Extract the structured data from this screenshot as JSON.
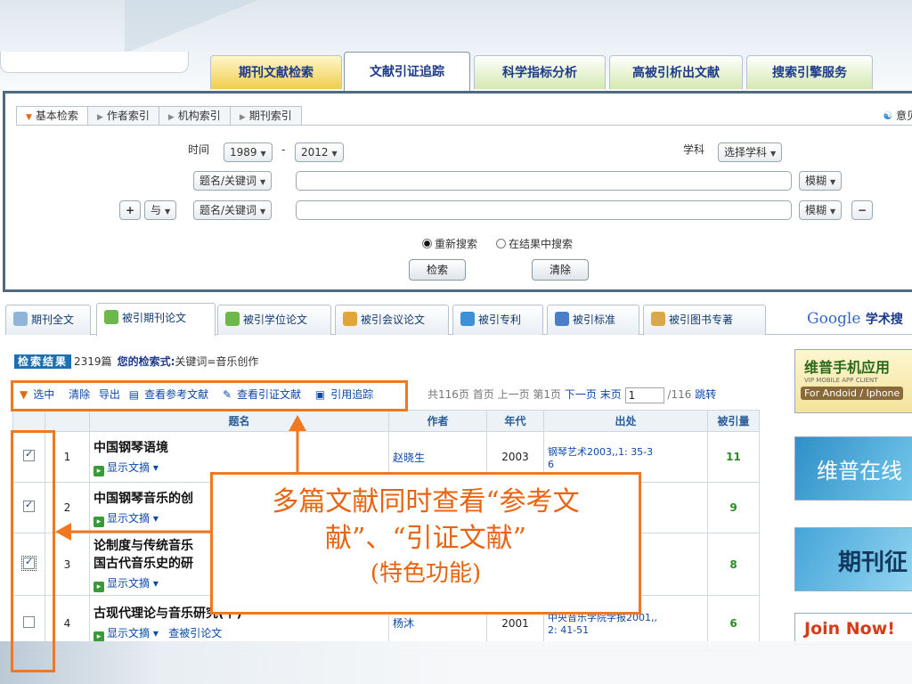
{
  "main_tabs": [
    "期刊文献检索",
    "文献引证追踪",
    "科学指标分析",
    "高被引析出文献",
    "搜索引擎服务"
  ],
  "sub_tabs": [
    "基本检索",
    "作者索引",
    "机构索引",
    "期刊索引"
  ],
  "feedback": "意见",
  "search": {
    "time_label": "时间",
    "year_from": "1989",
    "year_to": "2012",
    "dash": "-",
    "subject_label": "学科",
    "subject_value": "选择学科",
    "field1": "题名/关键词",
    "field2": "题名/关键词",
    "logic": "与",
    "plus": "+",
    "minus": "−",
    "match1": "模糊",
    "match2": "模糊",
    "radio_new": "重新搜索",
    "radio_within": "在结果中搜索",
    "search_btn": "检索",
    "clear_btn": "清除"
  },
  "result_tabs": [
    "期刊全文",
    "被引期刊论文",
    "被引学位论文",
    "被引会议论文",
    "被引专利",
    "被引标准",
    "被引图书专著"
  ],
  "google": {
    "logo": "Google",
    "suffix": "学术搜"
  },
  "result": {
    "header": "检索结果",
    "count": "2319篇",
    "query_label": "您的检索式:",
    "query_value": "关键词=音乐创作"
  },
  "tools": [
    "选中",
    "清除",
    "导出",
    "查看参考文献",
    "查看引证文献",
    "引用追踪"
  ],
  "pager": {
    "total": "共116页",
    "first": "首页",
    "prev": "上一页",
    "current": "第1页",
    "next": "下一页",
    "last": "末页",
    "page_value": "1",
    "of_total": "/116",
    "jump": "跳转"
  },
  "columns": [
    "题名",
    "作者",
    "年代",
    "出处",
    "被引量"
  ],
  "rows": [
    {
      "num": "1",
      "title": "中国钢琴语境",
      "title2": "",
      "abstract": "显示文摘",
      "extra": "",
      "author": "赵晓生",
      "year": "2003",
      "source": "钢琴艺术2003,,1: 35-3",
      "source2": "6",
      "cited": "11",
      "checked": true
    },
    {
      "num": "2",
      "title": "中国钢琴音乐的创",
      "title2": "",
      "abstract": "显示文摘",
      "extra": "",
      "author": "",
      "year": "",
      "source": "4: 96-1",
      "source2": "",
      "cited": "9",
      "checked": true
    },
    {
      "num": "3",
      "title": "论制度与传统音乐",
      "title2": "国古代音乐史的研",
      "abstract": "显示文摘",
      "extra": "",
      "author": "",
      "year": "",
      "source": "1: 18-2",
      "source2": "",
      "cited": "8",
      "checked": true
    },
    {
      "num": "4",
      "title": "古现代理论与音乐研究(下)",
      "title2": "",
      "abstract": "显示文摘",
      "extra": "查被引论文",
      "author": "杨沐",
      "year": "2001",
      "source": "中央音乐学院学报2001,,",
      "source2": "2: 41-51",
      "cited": "6",
      "checked": false
    }
  ],
  "ads": {
    "ad1_title": "维普手机应用",
    "ad1_sub": "VIP MOBILE APP CLIENT",
    "ad1_platform": "For Andoid / Iphone",
    "ad2": "维普在线",
    "ad3": "期刊征",
    "ad4": "Join Now!"
  },
  "callout": {
    "line1": "多篇文献同时查看“参考文",
    "line2": "献”、“引证文献”",
    "line3": "(特色功能)"
  },
  "colors": {
    "accent": "#f07820",
    "link": "#0b49a8",
    "cited": "#2c8a25",
    "panel_border": "#4e6a83"
  }
}
